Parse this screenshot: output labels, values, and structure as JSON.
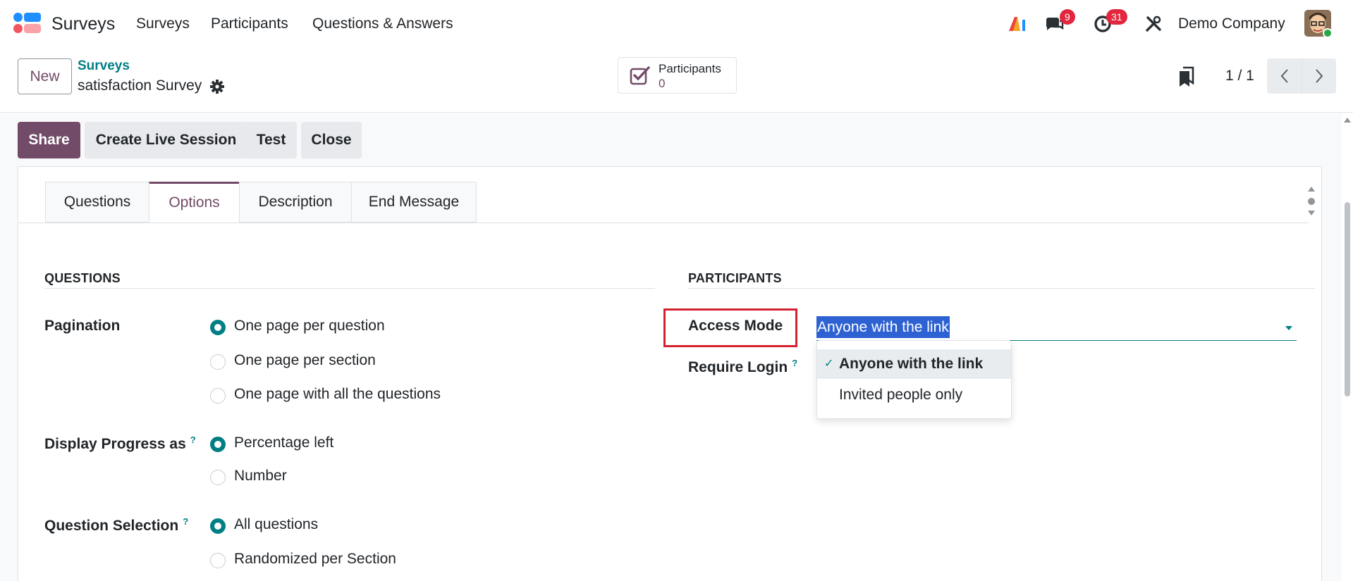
{
  "navbar": {
    "app_name": "Surveys",
    "menu": [
      "Surveys",
      "Participants",
      "Questions & Answers"
    ],
    "messages_badge": "9",
    "activities_badge": "31",
    "company": "Demo Company",
    "icons": [
      "apps-logo",
      "ai-icon",
      "chat-icon",
      "clock-icon",
      "tools-icon",
      "avatar"
    ]
  },
  "control_panel": {
    "new_label": "New",
    "breadcrumb_parent": "Surveys",
    "breadcrumb_current": "satisfaction Survey",
    "stat_button": {
      "label": "Participants",
      "value": "0"
    },
    "pager": "1 / 1"
  },
  "statusbar": {
    "share": "Share",
    "live_session": "Create Live Session",
    "test": "Test",
    "close": "Close"
  },
  "tabs": [
    "Questions",
    "Options",
    "Description",
    "End Message"
  ],
  "active_tab": "Options",
  "questions_section": {
    "title": "QUESTIONS",
    "pagination": {
      "label": "Pagination",
      "options": [
        "One page per question",
        "One page per section",
        "One page with all the questions"
      ],
      "selected": "One page per question"
    },
    "progress": {
      "label": "Display Progress as",
      "help": "?",
      "options": [
        "Percentage left",
        "Number"
      ],
      "selected": "Percentage left"
    },
    "selection": {
      "label": "Question Selection",
      "help": "?",
      "options": [
        "All questions",
        "Randomized per Section"
      ],
      "selected": "All questions"
    }
  },
  "participants_section": {
    "title": "PARTICIPANTS",
    "access_mode": {
      "label": "Access Mode",
      "value": "Anyone with the link",
      "options": [
        "Anyone with the link",
        "Invited people only"
      ],
      "check": "✓"
    },
    "require_login": {
      "label": "Require Login",
      "help": "?"
    }
  },
  "colors": {
    "brand": "#714b67",
    "accent": "#017e84",
    "badge": "#e1263d",
    "highlight": "#d4212f",
    "selection": "#2e62d3"
  }
}
